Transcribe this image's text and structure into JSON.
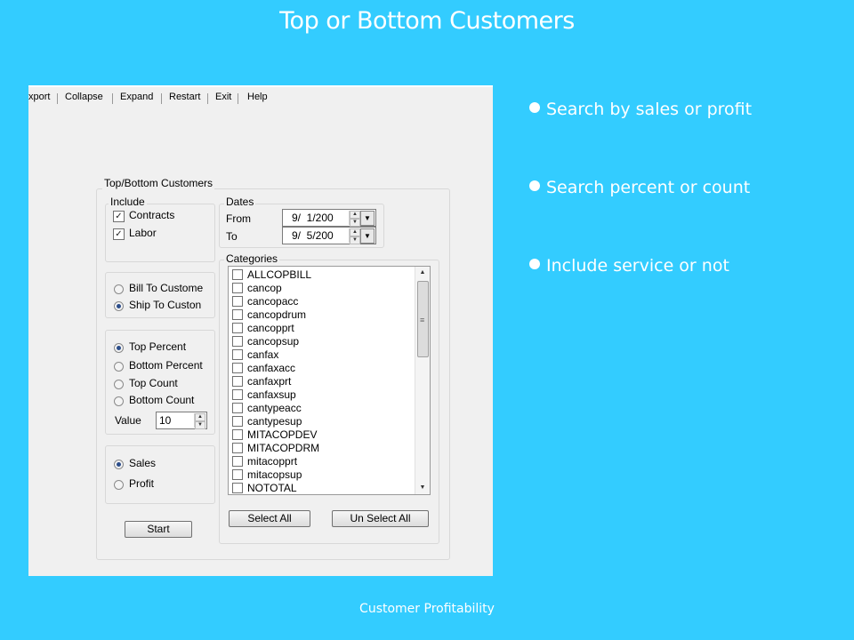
{
  "slide": {
    "title": "Top or Bottom Customers",
    "footer": "Customer Profitability",
    "bullets": [
      "Search by sales or profit",
      "Search percent or count",
      "Include service or not"
    ]
  },
  "menu": [
    "xport",
    "Collapse",
    "Expand",
    "Restart",
    "Exit",
    "Help"
  ],
  "form": {
    "group_title": "Top/Bottom Customers",
    "include": {
      "label": "Include",
      "contracts": "Contracts",
      "contracts_checked": true,
      "labor": "Labor",
      "labor_checked": true
    },
    "dates": {
      "label": "Dates",
      "from_label": "From",
      "from_value": "9/  1/200",
      "to_label": "To",
      "to_value": "9/  5/200"
    },
    "customer_type": {
      "bill_to": "Bill To Custome",
      "ship_to": "Ship To Custon",
      "selected": "ship_to"
    },
    "rank": {
      "top_percent": "Top Percent",
      "bottom_percent": "Bottom Percent",
      "top_count": "Top Count",
      "bottom_count": "Bottom Count",
      "selected": "top_percent",
      "value_label": "Value",
      "value": "10"
    },
    "measure": {
      "sales": "Sales",
      "profit": "Profit",
      "selected": "sales"
    },
    "start_button": "Start",
    "categories": {
      "label": "Categories",
      "items": [
        "ALLCOPBILL",
        "cancop",
        "cancopacc",
        "cancopdrum",
        "cancopprt",
        "cancopsup",
        "canfax",
        "canfaxacc",
        "canfaxprt",
        "canfaxsup",
        "cantypeacc",
        "cantypesup",
        "MITACOPDEV",
        "MITACOPDRM",
        "mitacopprt",
        "mitacopsup",
        "NOTOTAL"
      ],
      "select_all": "Select All",
      "unselect_all": "Un Select All"
    }
  },
  "colors": {
    "slide_background": "#33ccff",
    "window_background": "#f0f0f0",
    "radio_dot": "#2b4d8a"
  }
}
